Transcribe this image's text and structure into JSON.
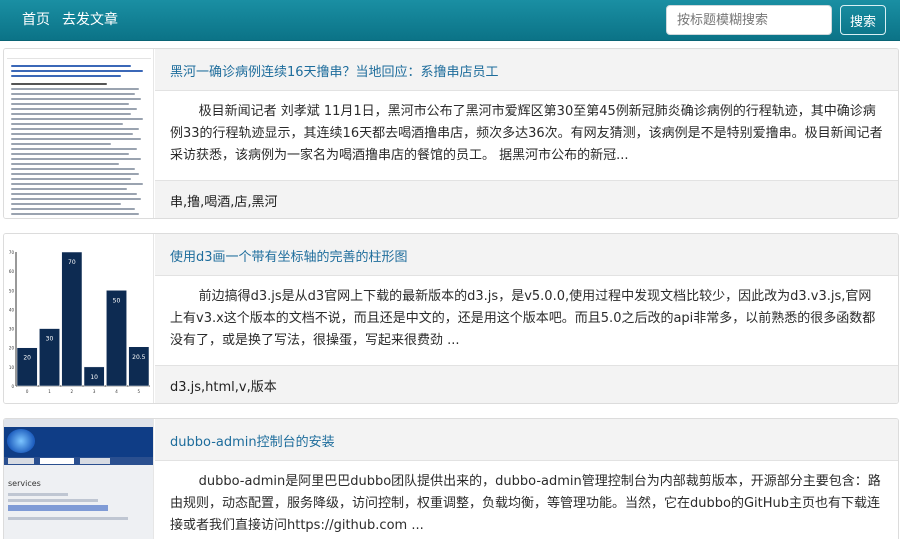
{
  "nav": {
    "home": "首页",
    "post": "去发文章",
    "search_placeholder": "按标题模糊搜索",
    "search_button": "搜索"
  },
  "articles": [
    {
      "title": "黑河一确诊病例连续16天撸串？当地回应：系撸串店员工",
      "summary": "极目新闻记者 刘孝斌 11月1日，黑河市公布了黑河市爱辉区第30至第45例新冠肺炎确诊病例的行程轨迹，其中确诊病例33的行程轨迹显示，其连续16天都去喝酒撸串店，频次多达36次。有网友猜测，该病例是不是特别爱撸串。极目新闻记者采访获悉，该病例为一家名为喝酒撸串店的餐馆的员工。 据黑河市公布的新冠...",
      "tags": "串,撸,喝酒,店,黑河"
    },
    {
      "title": "使用d3画一个带有坐标轴的完善的柱形图",
      "summary": "前边搞得d3.js是从d3官网上下载的最新版本的d3.js，是v5.0.0,使用过程中发现文档比较少，因此改为d3.v3.js,官网上有v3.x这个版本的文档不说，而且还是中文的，还是用这个版本吧。而且5.0之后改的api非常多，以前熟悉的很多函数都没有了，或是换了写法，很操蛋，写起来很费劲 ...",
      "tags": "d3.js,html,v,版本"
    },
    {
      "title": "dubbo-admin控制台的安装",
      "summary": "dubbo-admin是阿里巴巴dubbo团队提供出来的，dubbo-admin管理控制台为内部裁剪版本，开源部分主要包含：路由规则，动态配置，服务降级，访问控制，权重调整，负载均衡，等管理功能。当然，它在dubbo的GitHub主页也有下载连接或者我们直接访问https://github.com ...",
      "tags": ""
    }
  ],
  "thumb_chart": {
    "values": [
      20,
      30,
      70,
      10,
      50,
      20.5
    ],
    "labels": [
      "20",
      "30",
      "70",
      "10",
      "50",
      "20.5"
    ],
    "x_ticks": [
      "0",
      "1",
      "2",
      "3",
      "4",
      "5"
    ],
    "y_ticks": [
      "0",
      "10",
      "20",
      "30",
      "40",
      "50",
      "60",
      "70"
    ],
    "ymax": 70,
    "bar_color": "#0d2b52"
  },
  "thumb_dubbo": {
    "label": "services"
  },
  "colors": {
    "navbar": "#0e7f93",
    "title_link": "#1e6d9c"
  }
}
